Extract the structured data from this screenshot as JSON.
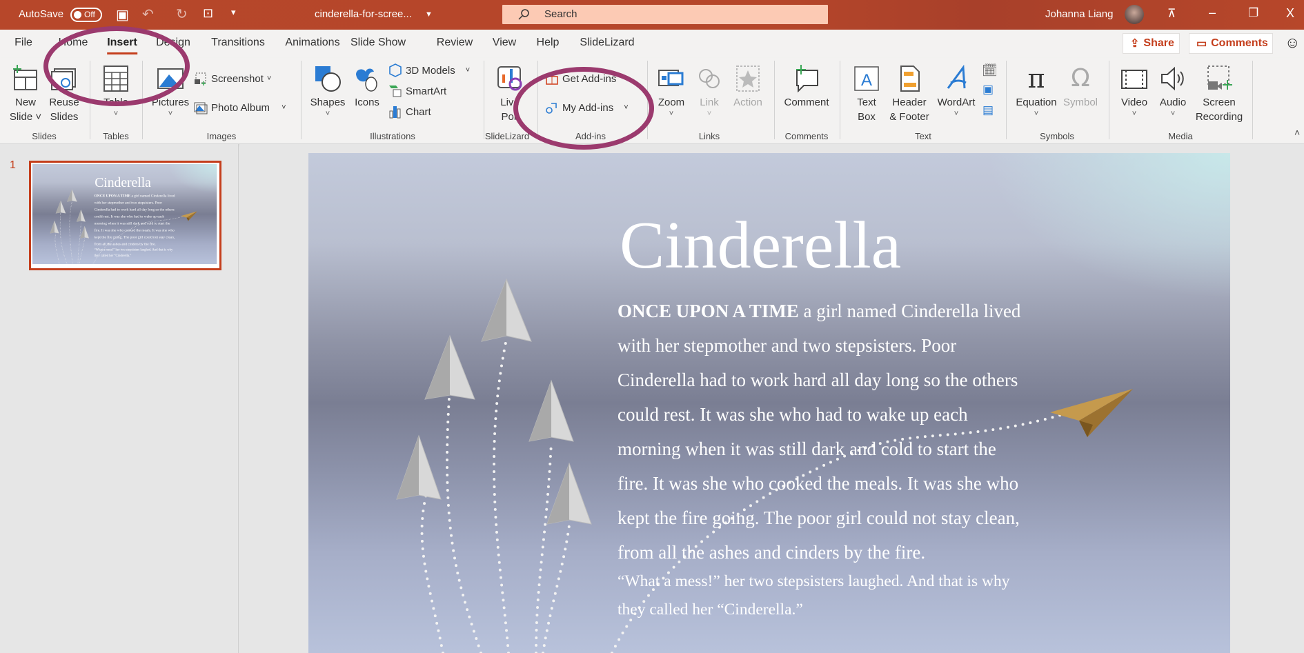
{
  "titlebar": {
    "autosave": "AutoSave",
    "autosave_state": "Off",
    "filename": "cinderella-for-scree...",
    "search_placeholder": "Search",
    "user": "Johanna Liang"
  },
  "tabs": [
    "File",
    "Home",
    "Insert",
    "Design",
    "Transitions",
    "Animations",
    "Slide Show",
    "Review",
    "View",
    "Help",
    "SlideLizard"
  ],
  "active_tab": "Insert",
  "share": "Share",
  "comments": "Comments",
  "ribbon": {
    "new_slide": [
      "New",
      "Slide"
    ],
    "reuse_slides": [
      "Reuse",
      "Slides"
    ],
    "table": "Table",
    "pictures": "Pictures",
    "screenshot": "Screenshot",
    "photo_album": "Photo Album",
    "shapes": "Shapes",
    "icons": "Icons",
    "models3d": "3D Models",
    "smartart": "SmartArt",
    "chart": "Chart",
    "live_poll": [
      "Live",
      "Poll"
    ],
    "get_addins": "Get Add-ins",
    "my_addins": "My Add-ins",
    "zoom": "Zoom",
    "link": "Link",
    "action": "Action",
    "comment": "Comment",
    "text_box": [
      "Text",
      "Box"
    ],
    "header_footer": [
      "Header",
      "& Footer"
    ],
    "wordart": "WordArt",
    "equation": "Equation",
    "symbol": "Symbol",
    "video": "Video",
    "audio": "Audio",
    "screen_recording": [
      "Screen",
      "Recording"
    ]
  },
  "groups": [
    "Slides",
    "Tables",
    "Images",
    "Illustrations",
    "SlideLizard",
    "Add-ins",
    "Links",
    "Comments",
    "Text",
    "Symbols",
    "Media"
  ],
  "thumbnail_number": "1",
  "slide": {
    "title": "Cinderella",
    "lead_bold": "ONCE UPON A TIME",
    "lines": [
      " a girl named Cinderella lived",
      "with her stepmother and two stepsisters.  Poor",
      "Cinderella had to work hard all day long so the others",
      "could rest. It was she who had to wake up each",
      "morning when it was still dark and cold to start the",
      "fire.  It was she who cooked the meals. It was she who",
      "kept the fire going. The poor girl could not stay clean,",
      "from all the ashes and cinders by the fire."
    ],
    "quote_lines": [
      "“What a mess!” her two stepsisters laughed.  And that is why",
      "they called her “Cinderella.”"
    ]
  },
  "colors": {
    "accent": "#b7472a",
    "annotation": "#9b3a6e"
  }
}
